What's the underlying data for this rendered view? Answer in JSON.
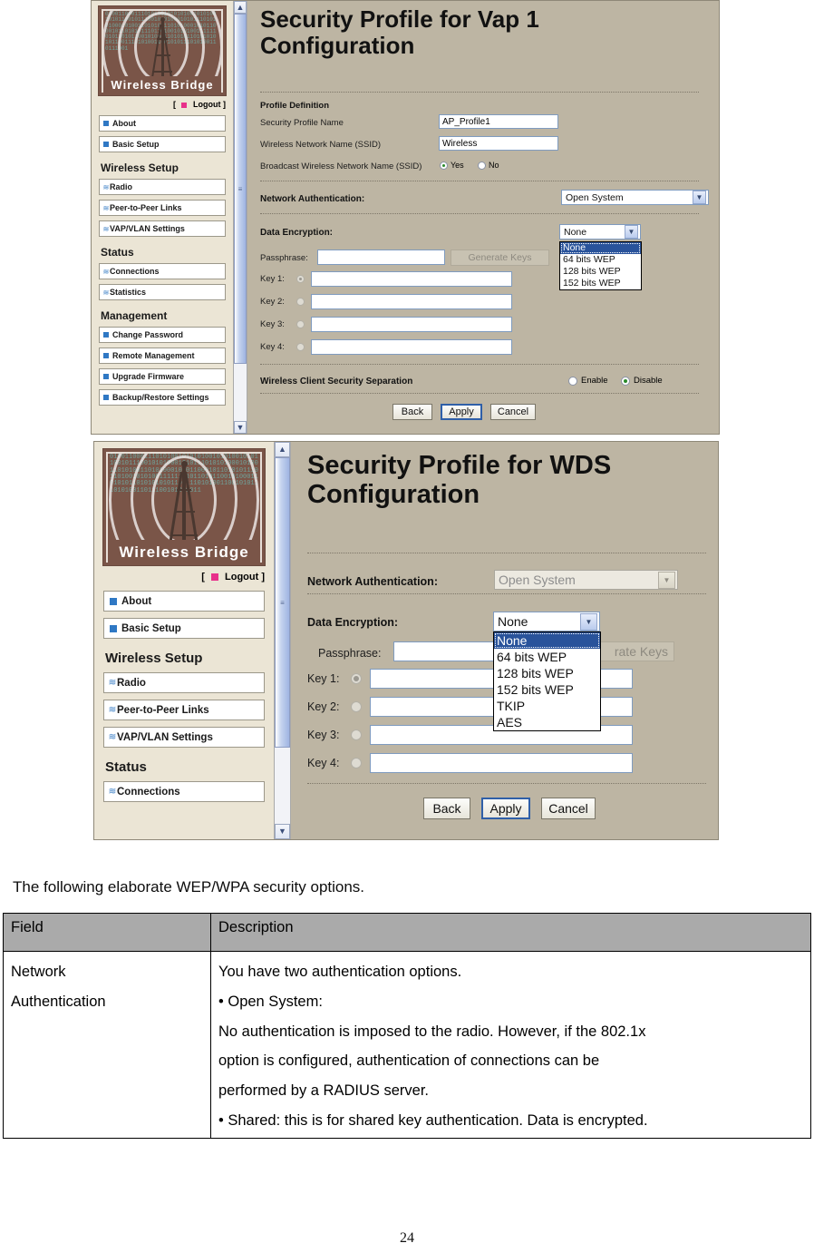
{
  "panel1": {
    "logo": {
      "label": "Wireless  Bridge",
      "alt": "wireless-bridge-logo"
    },
    "logout": {
      "bracket_open": "[",
      "label": "Logout",
      "bracket_close": "]"
    },
    "menu": [
      {
        "label": "About",
        "icon": "square-bullet"
      },
      {
        "label": "Basic Setup",
        "icon": "square-bullet"
      }
    ],
    "groups": [
      {
        "heading": "Wireless Setup",
        "items": [
          {
            "label": "Radio",
            "icon": "wave-bullet"
          },
          {
            "label": "Peer-to-Peer Links",
            "icon": "wave-bullet"
          },
          {
            "label": "VAP/VLAN Settings",
            "icon": "wave-bullet"
          }
        ]
      },
      {
        "heading": "Status",
        "items": [
          {
            "label": "Connections",
            "icon": "wave-bullet"
          },
          {
            "label": "Statistics",
            "icon": "wave-bullet"
          }
        ]
      },
      {
        "heading": "Management",
        "items": [
          {
            "label": "Change Password",
            "icon": "square-bullet"
          },
          {
            "label": "Remote Management",
            "icon": "square-bullet"
          },
          {
            "label": "Upgrade Firmware",
            "icon": "square-bullet"
          },
          {
            "label": "Backup/Restore Settings",
            "icon": "square-bullet"
          }
        ]
      }
    ],
    "title": "Security Profile for Vap 1 Configuration",
    "profile_definition": {
      "heading": "Profile Definition",
      "security_profile_name": {
        "label": "Security Profile Name",
        "value": "AP_Profile1"
      },
      "ssid": {
        "label": "Wireless Network Name (SSID)",
        "value": "Wireless"
      },
      "broadcast_ssid": {
        "label": "Broadcast Wireless Network Name (SSID)",
        "yes": "Yes",
        "no": "No",
        "selected": "Yes"
      }
    },
    "network_authentication": {
      "label": "Network Authentication:",
      "value": "Open System"
    },
    "data_encryption": {
      "label": "Data Encryption:",
      "value": "None",
      "options": [
        "None",
        "64 bits WEP",
        "128 bits WEP",
        "152 bits WEP"
      ],
      "selected_index": 0
    },
    "passphrase": {
      "label": "Passphrase:",
      "value": ""
    },
    "generate_keys_label": "Generate Keys",
    "keys": [
      {
        "label": "Key 1:",
        "value": "",
        "selected": true
      },
      {
        "label": "Key 2:",
        "value": "",
        "selected": false
      },
      {
        "label": "Key 3:",
        "value": "",
        "selected": false
      },
      {
        "label": "Key 4:",
        "value": "",
        "selected": false
      }
    ],
    "client_separation": {
      "label": "Wireless Client Security Separation",
      "enable": "Enable",
      "disable": "Disable",
      "selected": "Disable"
    },
    "buttons": {
      "back": "Back",
      "apply": "Apply",
      "cancel": "Cancel"
    }
  },
  "panel2": {
    "logo": {
      "label": "Wireless  Bridge",
      "alt": "wireless-bridge-logo"
    },
    "logout": {
      "bracket_open": "[",
      "label": "Logout",
      "bracket_close": "]"
    },
    "menu": [
      {
        "label": "About",
        "icon": "square-bullet"
      },
      {
        "label": "Basic Setup",
        "icon": "square-bullet"
      }
    ],
    "groups": [
      {
        "heading": "Wireless Setup",
        "items": [
          {
            "label": "Radio",
            "icon": "wave-bullet"
          },
          {
            "label": "Peer-to-Peer Links",
            "icon": "wave-bullet"
          },
          {
            "label": "VAP/VLAN Settings",
            "icon": "wave-bullet"
          }
        ]
      },
      {
        "heading": "Status",
        "items": [
          {
            "label": "Connections",
            "icon": "wave-bullet"
          }
        ]
      }
    ],
    "title": "Security Profile for WDS Configuration",
    "network_authentication": {
      "label": "Network Authentication:",
      "value": "Open System",
      "disabled": true
    },
    "data_encryption": {
      "label": "Data Encryption:",
      "value": "None",
      "options": [
        "None",
        "64 bits WEP",
        "128 bits WEP",
        "152 bits WEP",
        "TKIP",
        "AES"
      ],
      "selected_index": 0
    },
    "passphrase": {
      "label": "Passphrase:",
      "value": ""
    },
    "generate_keys_label": "rate Keys",
    "keys": [
      {
        "label": "Key 1:",
        "value": "",
        "selected": true
      },
      {
        "label": "Key 2:",
        "value": "",
        "selected": false
      },
      {
        "label": "Key 3:",
        "value": "",
        "selected": false
      },
      {
        "label": "Key 4:",
        "value": "",
        "selected": false
      }
    ],
    "buttons": {
      "back": "Back",
      "apply": "Apply",
      "cancel": "Cancel"
    }
  },
  "document": {
    "intro": "The following elaborate WEP/WPA security options.",
    "table": {
      "headers": [
        "Field",
        "Description"
      ],
      "rows": [
        {
          "field": [
            "Network",
            "Authentication"
          ],
          "description": [
            "You have two authentication options.",
            "• Open System:",
            "No authentication is imposed to the radio. However, if the 802.1x",
            "option is configured, authentication of connections can be",
            "performed by a RADIUS server.",
            "• Shared: this is for shared key authentication. Data is encrypted."
          ]
        }
      ]
    },
    "page_number": "24"
  },
  "colors": {
    "content_bg": "#bdb5a3",
    "sidebar_bg": "#ebe5d5",
    "logo_bg": "#7a5548",
    "logo_digits": "#6fa8a0",
    "accent_blue": "#2f78c4",
    "logout_pink": "#e8308a",
    "dropdown_highlight": "#29539b",
    "table_header_bg": "#aaaaaa",
    "radio_on": "#2a8a2a"
  }
}
